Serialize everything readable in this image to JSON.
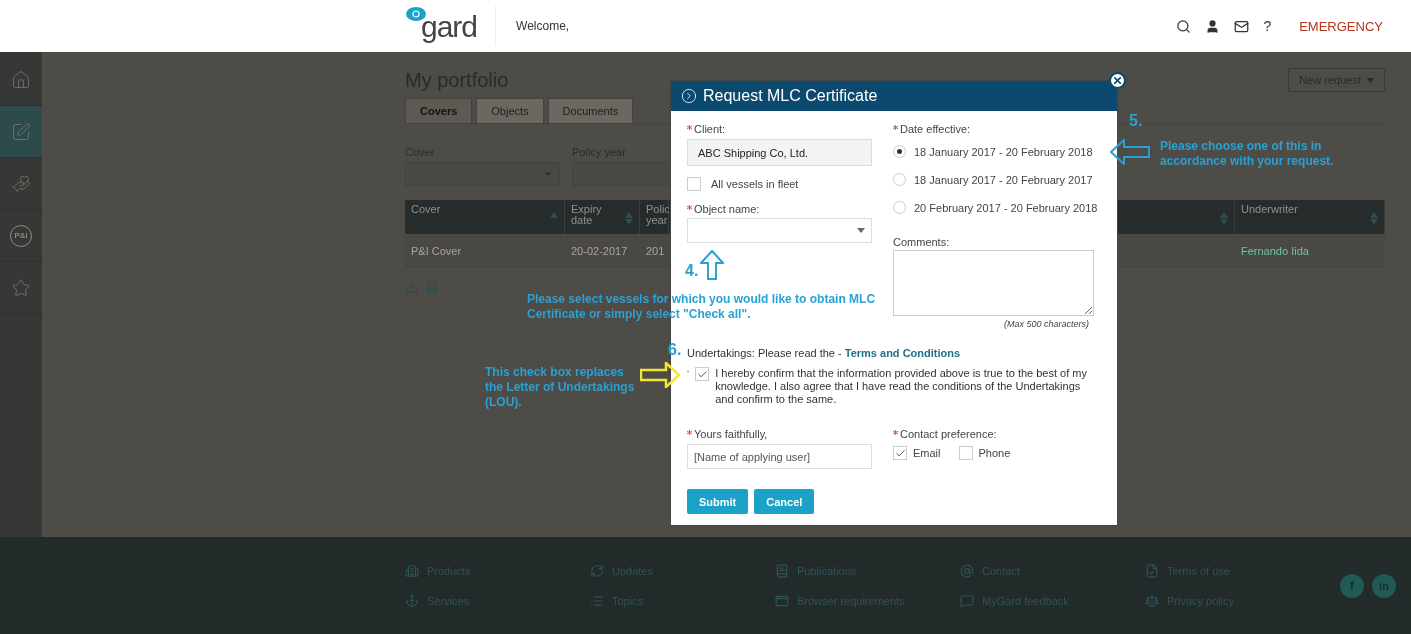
{
  "header": {
    "logo": "gard",
    "welcome": "Welcome,",
    "help": "?",
    "emergency": "EMERGENCY"
  },
  "sidebar": {
    "items": [
      {
        "kind": "home",
        "selected": false
      },
      {
        "kind": "edit",
        "selected": true
      },
      {
        "kind": "hands",
        "selected": false
      },
      {
        "kind": "badge",
        "label": "P&I",
        "selected": false
      },
      {
        "kind": "star",
        "selected": false
      }
    ]
  },
  "portfolio": {
    "title": "My portfolio",
    "new_request": "New request",
    "tabs": [
      {
        "label": "Covers",
        "selected": true
      },
      {
        "label": "Objects",
        "selected": false
      },
      {
        "label": "Documents",
        "selected": false
      }
    ],
    "filters": [
      {
        "label": "Cover"
      },
      {
        "label": "Policy year"
      }
    ],
    "table": {
      "columns": [
        {
          "kind": "text",
          "label": "Cover",
          "sorted": true
        },
        {
          "kind": "text",
          "label": "Expiry date",
          "sorted": false
        },
        {
          "kind": "text",
          "label": "Polic year"
        },
        {
          "kind": "covered",
          "sorted": false
        },
        {
          "kind": "text",
          "label": "Underwriter",
          "sorted": false
        }
      ],
      "rows": [
        {
          "cells": [
            "P&I Cover",
            "20-02-2017",
            "201",
            "Fernando Iida"
          ]
        }
      ]
    }
  },
  "modal": {
    "title": "Request MLC Certificate",
    "client": {
      "label": "Client:",
      "value": "ABC Shipping Co, Ltd.",
      "required": true
    },
    "all_vessels": {
      "label": "All vessels in fleet",
      "checked": false
    },
    "object_name": {
      "label": "Object name:",
      "required": true
    },
    "date_effective": {
      "label": "Date effective:",
      "required": true,
      "options": [
        {
          "label": "18 January 2017 - 20 February 2018",
          "selected": true
        },
        {
          "label": "18 January 2017 - 20 February 2017",
          "selected": false
        },
        {
          "label": "20 February 2017 - 20 February 2018",
          "selected": false
        }
      ]
    },
    "comments": {
      "label": "Comments:",
      "note": "(Max 500 characters)"
    },
    "undertakings": {
      "text": "Undertakings: Please read the - ",
      "link": "Terms and Conditions"
    },
    "confirm": {
      "text": "I hereby confirm that the information provided above is true to the best of my knowledge. I also agree that I have read the conditions of the Undertakings and confirm to the same.",
      "checked": true,
      "required": true
    },
    "yours_faithfully": {
      "label": "Yours faithfully,",
      "value": "[Name of applying user]",
      "required": true
    },
    "contact": {
      "label": "Contact preference:",
      "required": true,
      "options": [
        {
          "label": "Email",
          "checked": true
        },
        {
          "label": "Phone",
          "checked": false
        }
      ]
    },
    "buttons": [
      "Submit",
      "Cancel"
    ]
  },
  "annotations": [
    {
      "number": "4.",
      "color": "#2aa0d4",
      "text": "Please select vessels for which you would like to obtain MLC Certificate or simply select \"Check all\"."
    },
    {
      "number": "5.",
      "color": "#2aa0d4",
      "text": "Please choose one of this in accordance with your request."
    },
    {
      "number": "6.",
      "color": "#f2e635",
      "text": "This check box replaces the Letter of Undertakings (LOU)."
    }
  ],
  "footer": {
    "links": [
      {
        "kind": "building",
        "label": "Products"
      },
      {
        "kind": "refresh",
        "label": "Updates"
      },
      {
        "kind": "book",
        "label": "Publications"
      },
      {
        "kind": "at",
        "label": "Contact"
      },
      {
        "kind": "file",
        "label": "Terms of use"
      },
      {
        "kind": "anchor",
        "label": "Services"
      },
      {
        "kind": "list",
        "label": "Topics"
      },
      {
        "kind": "window",
        "label": "Browser requirements"
      },
      {
        "kind": "message",
        "label": "MyGard feedback"
      },
      {
        "kind": "scale",
        "label": "Privacy policy"
      }
    ],
    "social": [
      {
        "kind": "facebook",
        "label": "f"
      },
      {
        "kind": "linkedin",
        "label": "in"
      }
    ]
  }
}
